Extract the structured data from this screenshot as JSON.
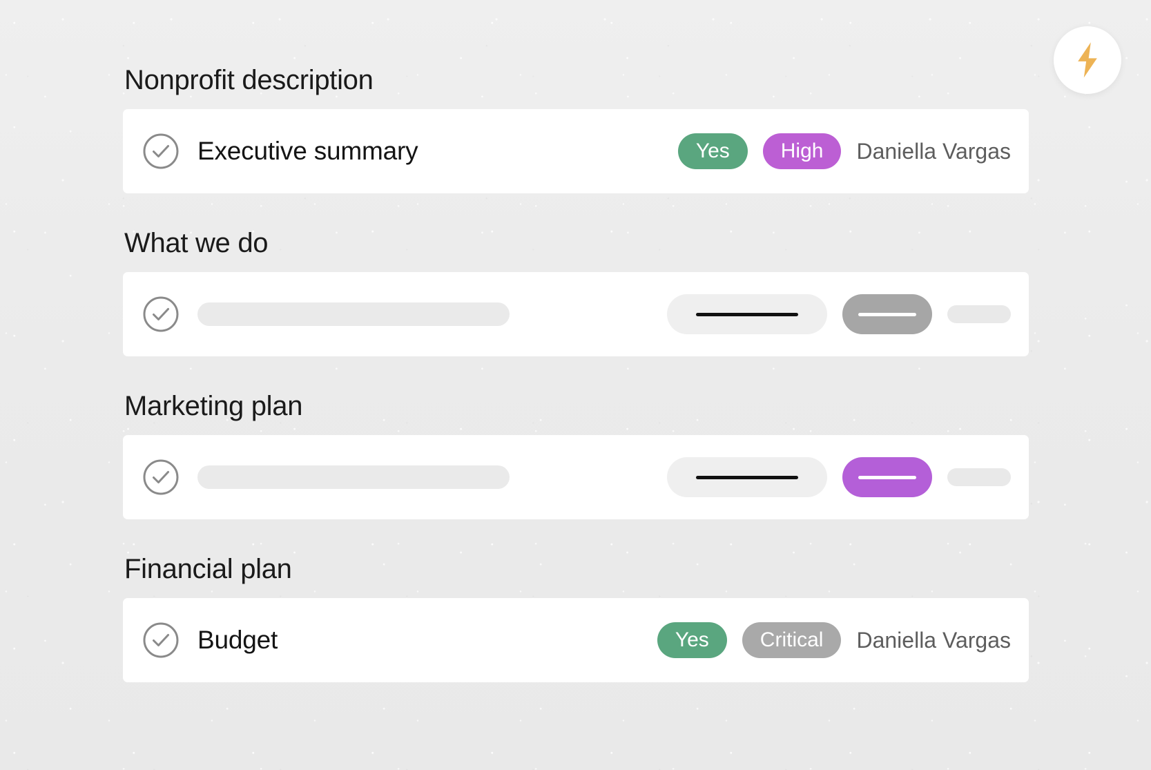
{
  "topbar": {
    "bolt_button": {
      "icon": "lightning-bolt-icon",
      "icon_color": "#edb355",
      "background": "#ffffff"
    }
  },
  "theme": {
    "page_background": "#ececec",
    "card_background": "#ffffff",
    "heading_color": "#1a1a1a",
    "assignee_color": "#5d5d5d",
    "check_icon_color": "#8a8a8a",
    "badge_yes": "#5aa67f",
    "badge_high": "#bc5fd4",
    "badge_critical": "#a9a9a9",
    "skeleton_gray": "#eaeaea",
    "skeleton_pill_gray": "#a6a6a6",
    "skeleton_pill_purple": "#b45fd8"
  },
  "sections": [
    {
      "title": "Nonprofit description",
      "row": {
        "type": "filled",
        "check_icon": "check-circle-icon",
        "label": "Executive summary",
        "badges": [
          {
            "label": "Yes",
            "color": "#5aa67f",
            "name": "status-badge-yes"
          },
          {
            "label": "High",
            "color": "#bc5fd4",
            "name": "priority-badge-high"
          }
        ],
        "assignee": "Daniella Vargas"
      }
    },
    {
      "title": "What we do",
      "row": {
        "type": "skeleton",
        "check_icon": "check-circle-icon",
        "accent_pill_color": "#a6a6a6"
      }
    },
    {
      "title": "Marketing plan",
      "row": {
        "type": "skeleton",
        "check_icon": "check-circle-icon",
        "accent_pill_color": "#b45fd8"
      }
    },
    {
      "title": "Financial plan",
      "row": {
        "type": "filled",
        "check_icon": "check-circle-icon",
        "label": "Budget",
        "badges": [
          {
            "label": "Yes",
            "color": "#5aa67f",
            "name": "status-badge-yes"
          },
          {
            "label": "Critical",
            "color": "#a9a9a9",
            "name": "priority-badge-critical"
          }
        ],
        "assignee": "Daniella Vargas"
      }
    }
  ]
}
